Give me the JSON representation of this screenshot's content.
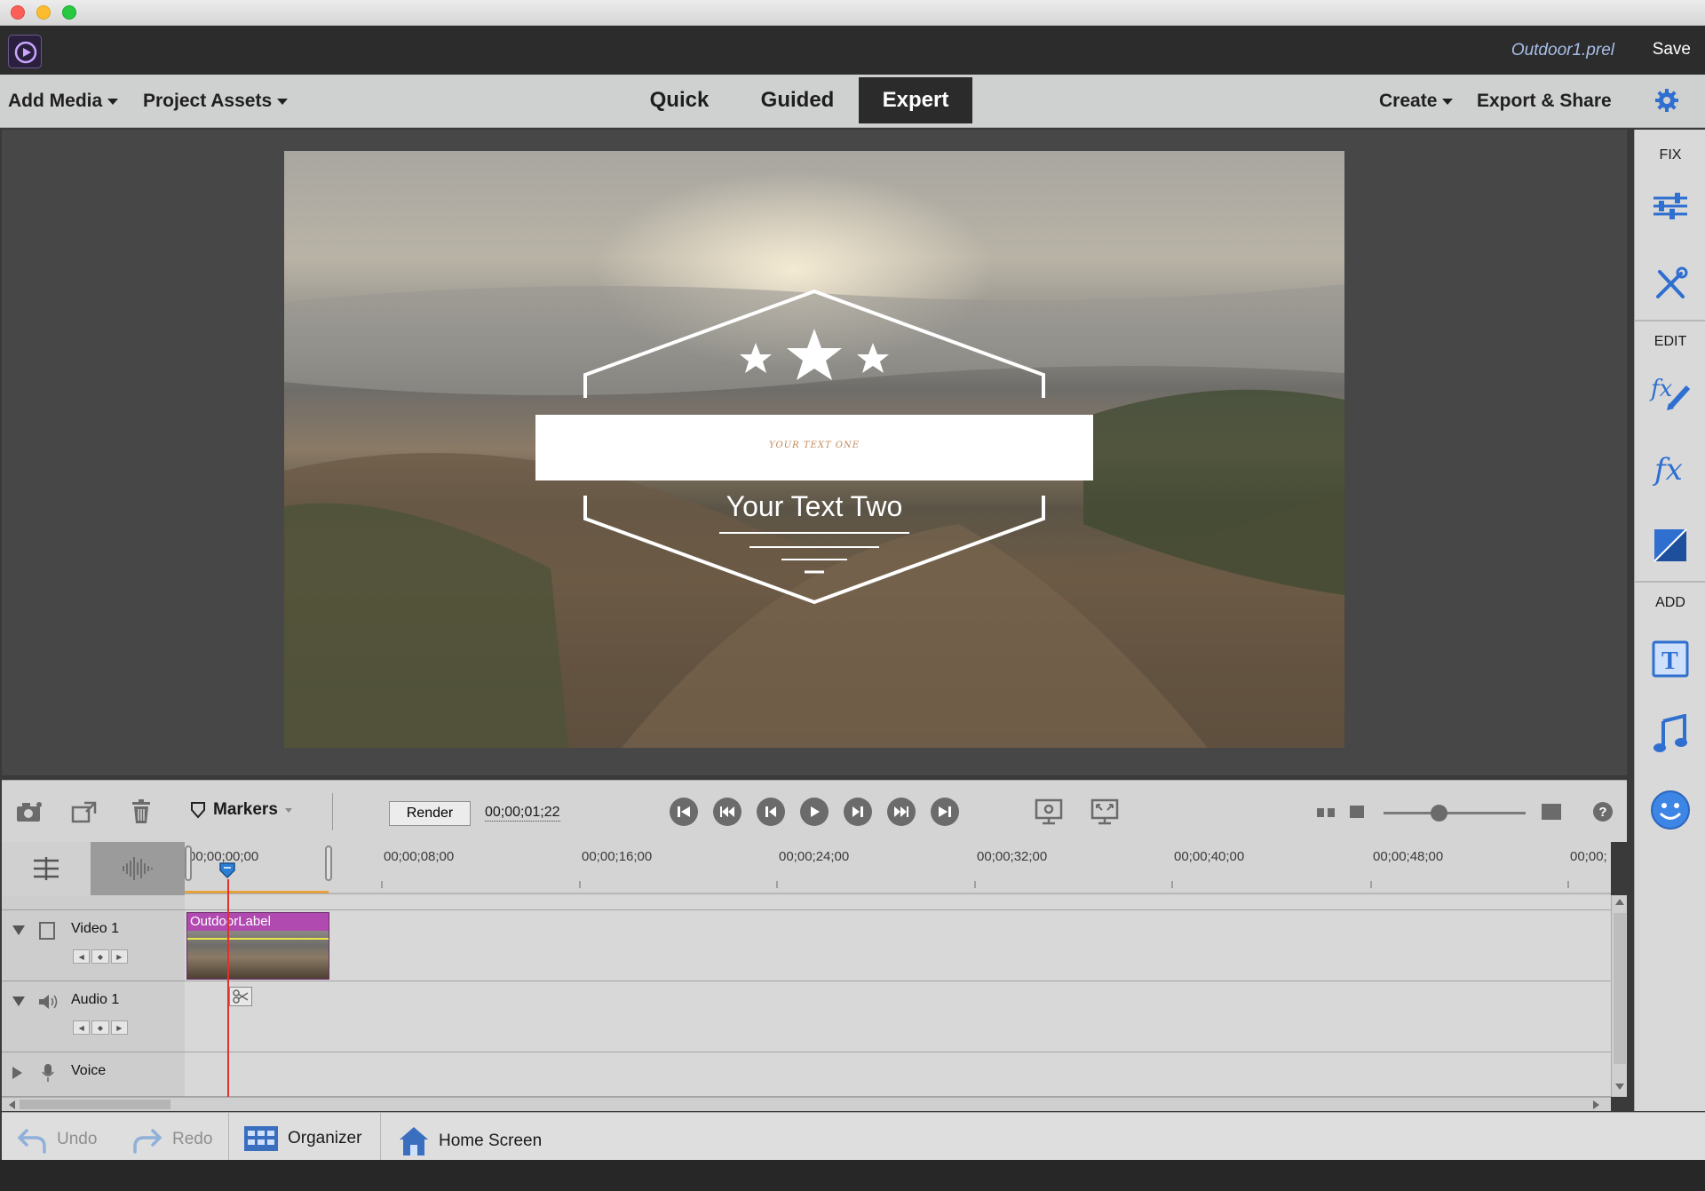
{
  "window": {
    "title_bar": ""
  },
  "header": {
    "filename": "Outdoor1.prel",
    "save_label": "Save"
  },
  "menubar": {
    "add_media": "Add Media",
    "project_assets": "Project Assets",
    "modes": [
      "Quick",
      "Guided",
      "Expert"
    ],
    "active_mode": "Expert",
    "create": "Create",
    "export_share": "Export & Share"
  },
  "preview": {
    "title_line_one": "YOUR TEXT ONE",
    "title_line_two": "Your Text Two"
  },
  "right_panel": {
    "fix_label": "FIX",
    "edit_label": "EDIT",
    "add_label": "ADD",
    "icons": [
      "adjust-icon",
      "tools-icon",
      "applied-effects-icon",
      "effects-icon",
      "transitions-icon",
      "titles-icon",
      "music-icon",
      "graphics-icon"
    ]
  },
  "timeline_toolbar": {
    "markers_label": "Markers",
    "render_label": "Render",
    "timecode": "00;00;01;22"
  },
  "ruler": {
    "ticks": [
      "00;00;00;00",
      "00;00;08;00",
      "00;00;16;00",
      "00;00;24;00",
      "00;00;32;00",
      "00;00;40;00",
      "00;00;48;00",
      "00;00;"
    ]
  },
  "tracks": [
    {
      "name": "Video 1",
      "type": "video"
    },
    {
      "name": "Audio 1",
      "type": "audio"
    },
    {
      "name": "Voice",
      "type": "voice"
    }
  ],
  "clip": {
    "label": "OutdoorLabel"
  },
  "bottom_bar": {
    "undo": "Undo",
    "redo": "Redo",
    "organizer": "Organizer",
    "home_screen": "Home Screen"
  },
  "colors": {
    "accent": "#c051c0",
    "clip": "#b04ab0",
    "playhead": "#e03030",
    "filename": "#a8bfe8"
  }
}
